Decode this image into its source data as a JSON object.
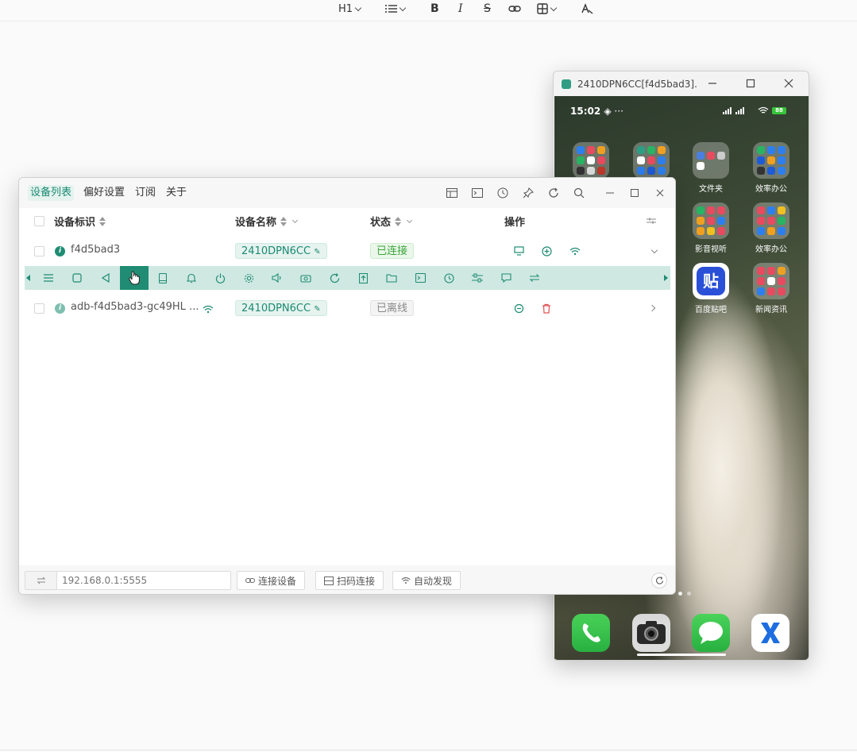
{
  "editor_toolbar": {
    "heading_label": "H1",
    "items": [
      "list",
      "bold",
      "italic",
      "strikethrough",
      "link",
      "table",
      "clear-format"
    ],
    "bold_label": "B",
    "italic_label": "I",
    "strike_label": "S"
  },
  "phone_window": {
    "title": "2410DPN6CC[f4d5bad3]...",
    "status_time": "15:02",
    "battery": "88",
    "apps": [
      {
        "label": ""
      },
      {
        "label": ""
      },
      {
        "label": "文件夹"
      },
      {
        "label": "效率办公"
      },
      {
        "label": "影音视听"
      },
      {
        "label": "效率办公"
      },
      {
        "label": "百度贴吧"
      },
      {
        "label": "新闻资讯"
      }
    ],
    "tieba_glyph": "贴",
    "dock_apps": [
      "phone",
      "camera",
      "messages",
      "x-browser"
    ]
  },
  "main_window": {
    "tabs": [
      "设备列表",
      "偏好设置",
      "订阅",
      "关于"
    ],
    "active_tab": "设备列表",
    "columns": {
      "id": "设备标识",
      "name": "设备名称",
      "status": "状态",
      "actions": "操作"
    },
    "rows": [
      {
        "id": "f4d5bad3",
        "name": "2410DPN6CC",
        "status": "已连接"
      },
      {
        "id": "adb-f4d5bad3-gc49HL ...",
        "name": "2410DPN6CC",
        "status": "已离线"
      }
    ],
    "ip_placeholder": "192.168.0.1:5555",
    "buttons": {
      "connect": "连接设备",
      "qr_connect": "扫码连接",
      "auto_discover": "自动发现"
    },
    "colors": {
      "accent": "#1f8c73",
      "toolstrip_bg": "#cfe8e2",
      "connected": "#3aa53a",
      "delete": "#e05050"
    }
  }
}
